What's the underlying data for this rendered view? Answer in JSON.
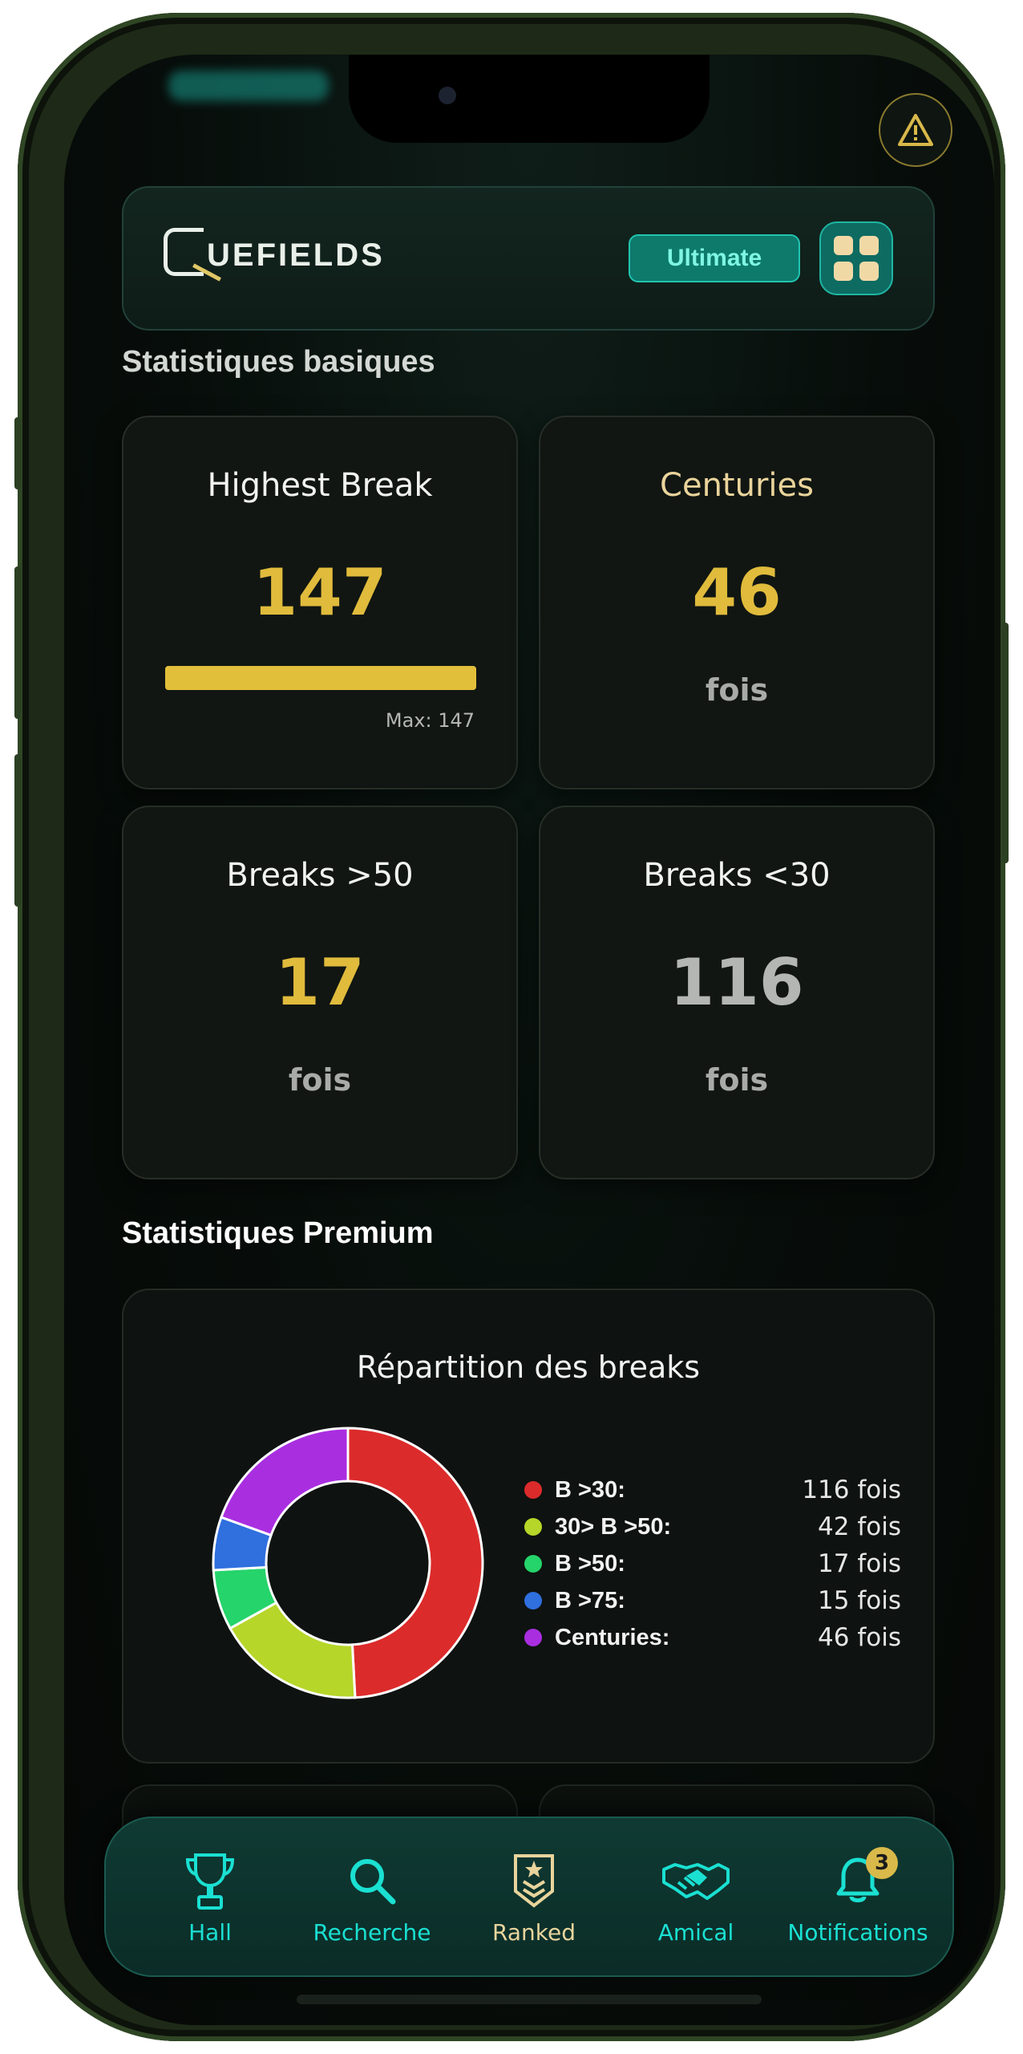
{
  "app": {
    "logo_text": "UEFIELDS",
    "plan_badge": "Ultimate"
  },
  "icons": {
    "alert": "warning-triangle-icon",
    "menu": "grid-icon"
  },
  "sections": {
    "basic_title": "Statistiques basiques",
    "premium_title": "Statistiques Premium"
  },
  "stats": [
    {
      "title": "Highest Break",
      "value": "147",
      "bar_max_label": "Max: 147",
      "bar_fraction": 1.0,
      "value_color": "#e0bb3c"
    },
    {
      "title": "Centuries",
      "value": "46",
      "unit": "fois",
      "value_color": "#e0bb3c"
    },
    {
      "title": "Breaks >50",
      "value": "17",
      "unit": "fois",
      "value_color": "#e0bb3c"
    },
    {
      "title": "Breaks <30",
      "value": "116",
      "unit": "fois",
      "value_color": "#b3b6b3"
    }
  ],
  "chart_data": {
    "type": "pie",
    "title": "Répartition des breaks",
    "categories": [
      "B >30:",
      "30> B >50:",
      "B >50:",
      "B >75:",
      "Centuries:"
    ],
    "values": [
      116,
      42,
      17,
      15,
      46
    ],
    "value_labels": [
      "116 fois",
      "42 fois",
      "17 fois",
      "15 fois",
      "46 fois"
    ],
    "colors": [
      "#dc2b2b",
      "#b6d629",
      "#25d46a",
      "#2f6fde",
      "#a92ee0"
    ],
    "donut": true,
    "legend": "right"
  },
  "tabs": [
    {
      "label": "Hall",
      "icon": "trophy-icon",
      "color": "#1ae0d2"
    },
    {
      "label": "Recherche",
      "icon": "search-icon",
      "color": "#1ae0d2"
    },
    {
      "label": "Ranked",
      "icon": "rank-badge-icon",
      "color": "#e8d49c"
    },
    {
      "label": "Amical",
      "icon": "handshake-icon",
      "color": "#1ae0d2"
    },
    {
      "label": "Notifications",
      "icon": "bell-icon",
      "color": "#1ae0d2",
      "badge": "3"
    }
  ]
}
